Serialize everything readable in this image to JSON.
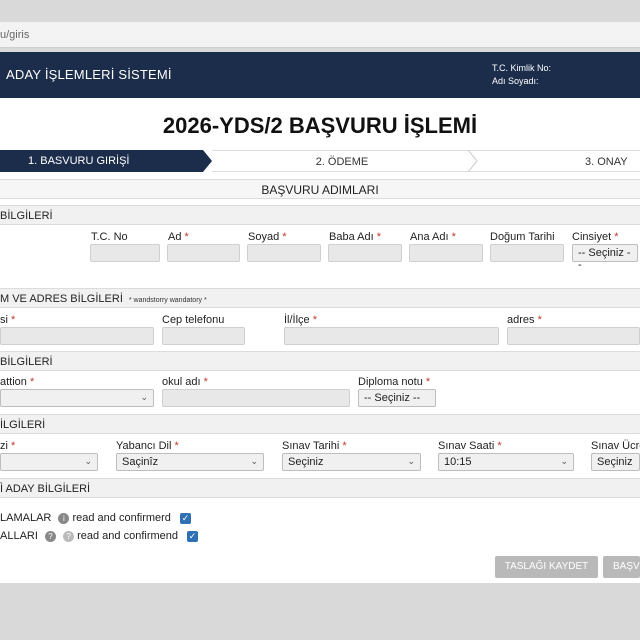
{
  "browser": {
    "url": "u/giris"
  },
  "header": {
    "app_title": "ADAY İŞLEMLERİ SİSTEMİ",
    "tc_label": "T.C. Kimlik No:",
    "name_label": "Adı Soyadı:"
  },
  "page": {
    "title": "2026-YDS/2 BAŞVURU İŞLEMİ"
  },
  "steps": [
    {
      "label": "1. BASVURU GIRİŞİ",
      "active": true
    },
    {
      "label": "2. ÖDEME",
      "active": false
    },
    {
      "label": "3. ONAY",
      "active": false
    }
  ],
  "sections": {
    "adimlar": "BAŞVURU ADIMLARI",
    "kimlik": "BİLGİLERİ",
    "iletisim": "M VE ADRES BİLGİLERİ",
    "iletisim_note": "* wandstorry wandatory *",
    "ogrenim": "BİLGİLERİ",
    "sinav": "İLGİLERİ",
    "diger": "Ì ADAY BİLGİLERİ"
  },
  "kimlik": {
    "tc_label": "T.C. No",
    "ad_label": "Ad",
    "soyad_label": "Soyad",
    "baba_label": "Baba Adı",
    "ana_label": "Ana Adı",
    "dogum_label": "Doğum Tarihi",
    "cinsiyet_label": "Cinsiyet",
    "cinsiyet_value": "-- Seçiniz --"
  },
  "iletisim": {
    "email_label": "si",
    "cep_label": "Cep telefonu",
    "il_label": "İl/İlçe",
    "adres_label": "adres"
  },
  "ogrenim": {
    "mezun_label": "attion",
    "okul_label": "okul adı",
    "diploma_label": "Diploma notu",
    "diploma_value": "-- Seçiniz --"
  },
  "sinav": {
    "merkez_label": "zi",
    "dil_label": "Yabancı Dil",
    "dil_value": "Saçinîz",
    "tarih_label": "Sınav Tarihi",
    "tarih_value": "Seçiniz",
    "saat_label": "Sınav Saati",
    "saat_value": "10:15",
    "ucret_label": "Sınav Ücret",
    "ucret_value": "Seçiniz"
  },
  "diger": {
    "row1_label": "LAMALAR",
    "row1_info": "i",
    "row1_text": "read and confirmerd",
    "row2_label": "ALLARI",
    "row2_info1": "?",
    "row2_info2": "?",
    "row2_text": "read and confirmend"
  },
  "actions": {
    "draft_label": "TASLAĞI KAYDET",
    "submit_label": "BAŞV"
  },
  "colors": {
    "navy": "#1b2d4a",
    "required": "#c0392b",
    "checkbox": "#2f6fb3"
  }
}
